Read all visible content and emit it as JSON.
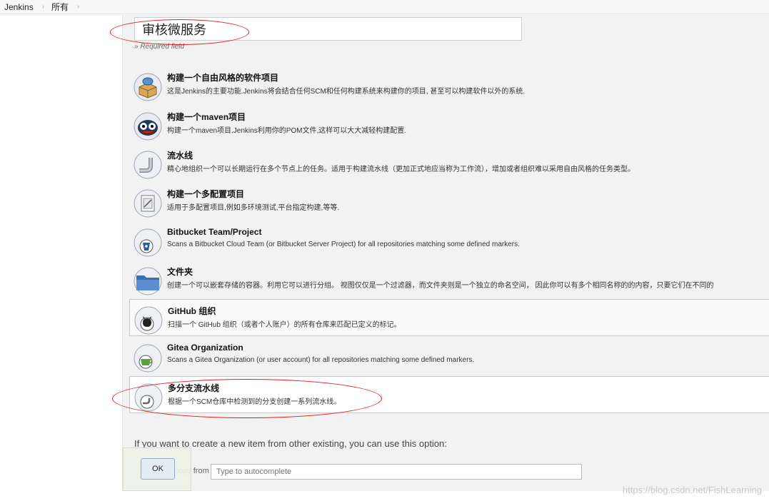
{
  "breadcrumb": {
    "items": [
      "Jenkins",
      "所有"
    ]
  },
  "name_field": {
    "value": "审核微服务",
    "hint": "» Required field"
  },
  "item_types": [
    {
      "title": "构建一个自由风格的软件项目",
      "description": "这是Jenkins的主要功能.Jenkins将会结合任何SCM和任何构建系统来构建你的项目, 甚至可以构建软件以外的系统.",
      "icon": "freestyle-box-icon"
    },
    {
      "title": "构建一个maven项目",
      "description": "构建一个maven项目.Jenkins利用你的POM文件,这样可以大大减轻构建配置.",
      "icon": "maven-owl-icon"
    },
    {
      "title": "流水线",
      "description": "精心地组织一个可以长期运行在多个节点上的任务。适用于构建流水线（更加正式地应当称为工作流），增加或者组织难以采用自由风格的任务类型。",
      "icon": "pipeline-pipe-icon"
    },
    {
      "title": "构建一个多配置项目",
      "description": "适用于多配置项目,例如多环境测试,平台指定构建,等等.",
      "icon": "matrix-project-icon"
    },
    {
      "title": "Bitbucket Team/Project",
      "description": "Scans a Bitbucket Cloud Team (or Bitbucket Server Project) for all repositories matching some defined markers.",
      "icon": "bitbucket-icon"
    },
    {
      "title": "文件夹",
      "description": "创建一个可以嵌套存储的容器。利用它可以进行分组。 视图仅仅是一个过滤器，而文件夹则是一个独立的命名空间， 因此你可以有多个相同名称的的内容，只要它们在不同的",
      "icon": "folder-icon"
    },
    {
      "title": "GitHub 组织",
      "description": "扫描一个 GitHub 组织（或者个人账户）的所有仓库来匹配已定义的标记。",
      "icon": "github-octocat-icon"
    },
    {
      "title": "Gitea Organization",
      "description": "Scans a Gitea Organization (or user account) for all repositories matching some defined markers.",
      "icon": "gitea-teacup-icon"
    },
    {
      "title": "多分支流水线",
      "description": "根据一个SCM仓库中检测到的分支创建一系列流水线。",
      "icon": "multibranch-pipeline-icon"
    }
  ],
  "copy_section": {
    "text": "If you want to create a new item from other existing, you can use this option:",
    "label": "Copy from",
    "placeholder": "Type to autocomplete"
  },
  "ok_button": {
    "label": "OK"
  },
  "watermark": "https://blog.csdn.net/FishLearning",
  "colors": {
    "annotation": "#e02020",
    "panel_bg": "#f2f2f2"
  }
}
